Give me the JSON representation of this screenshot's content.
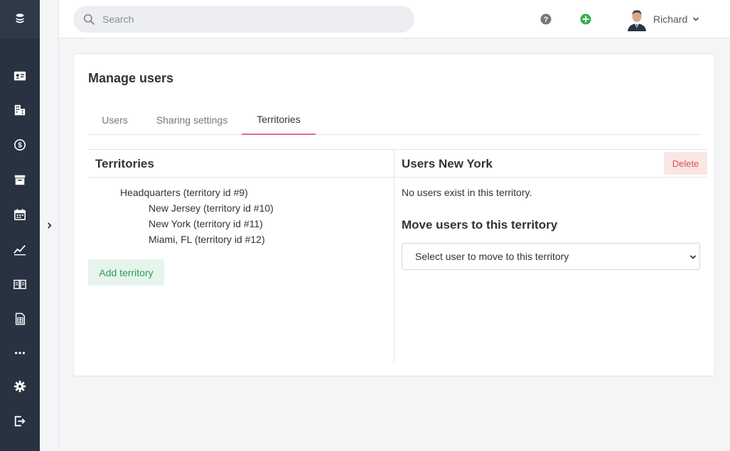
{
  "search": {
    "placeholder": "Search"
  },
  "user": {
    "name": "Richard"
  },
  "page": {
    "title": "Manage users"
  },
  "tabs": [
    {
      "label": "Users"
    },
    {
      "label": "Sharing settings"
    },
    {
      "label": "Territories",
      "active": true
    }
  ],
  "territories": {
    "title": "Territories",
    "items": [
      {
        "label": "Headquarters (territory id #9)",
        "level": 0
      },
      {
        "label": "New Jersey (territory id #10)",
        "level": 1
      },
      {
        "label": "New York (territory id #11)",
        "level": 1
      },
      {
        "label": "Miami, FL (territory id #12)",
        "level": 1
      }
    ],
    "add_label": "Add territory"
  },
  "detail": {
    "title": "Users New York",
    "delete_label": "Delete",
    "empty_message": "No users exist in this territory.",
    "move_title": "Move users to this territory",
    "select_placeholder": "Select user to move to this territory"
  },
  "sidebar": {
    "icons": [
      "logo-icon",
      "contact-card-icon",
      "buildings-icon",
      "dollar-icon",
      "archive-icon",
      "calendar-icon",
      "chart-line-icon",
      "book-icon",
      "spreadsheet-icon",
      "more-icon",
      "gear-icon",
      "logout-icon"
    ]
  },
  "colors": {
    "sidebar": "#283240",
    "accent_tab": "#e36b8c",
    "add_green": "#2e9a5b",
    "help_gray": "#777777",
    "delete_red": "#d9534f"
  }
}
